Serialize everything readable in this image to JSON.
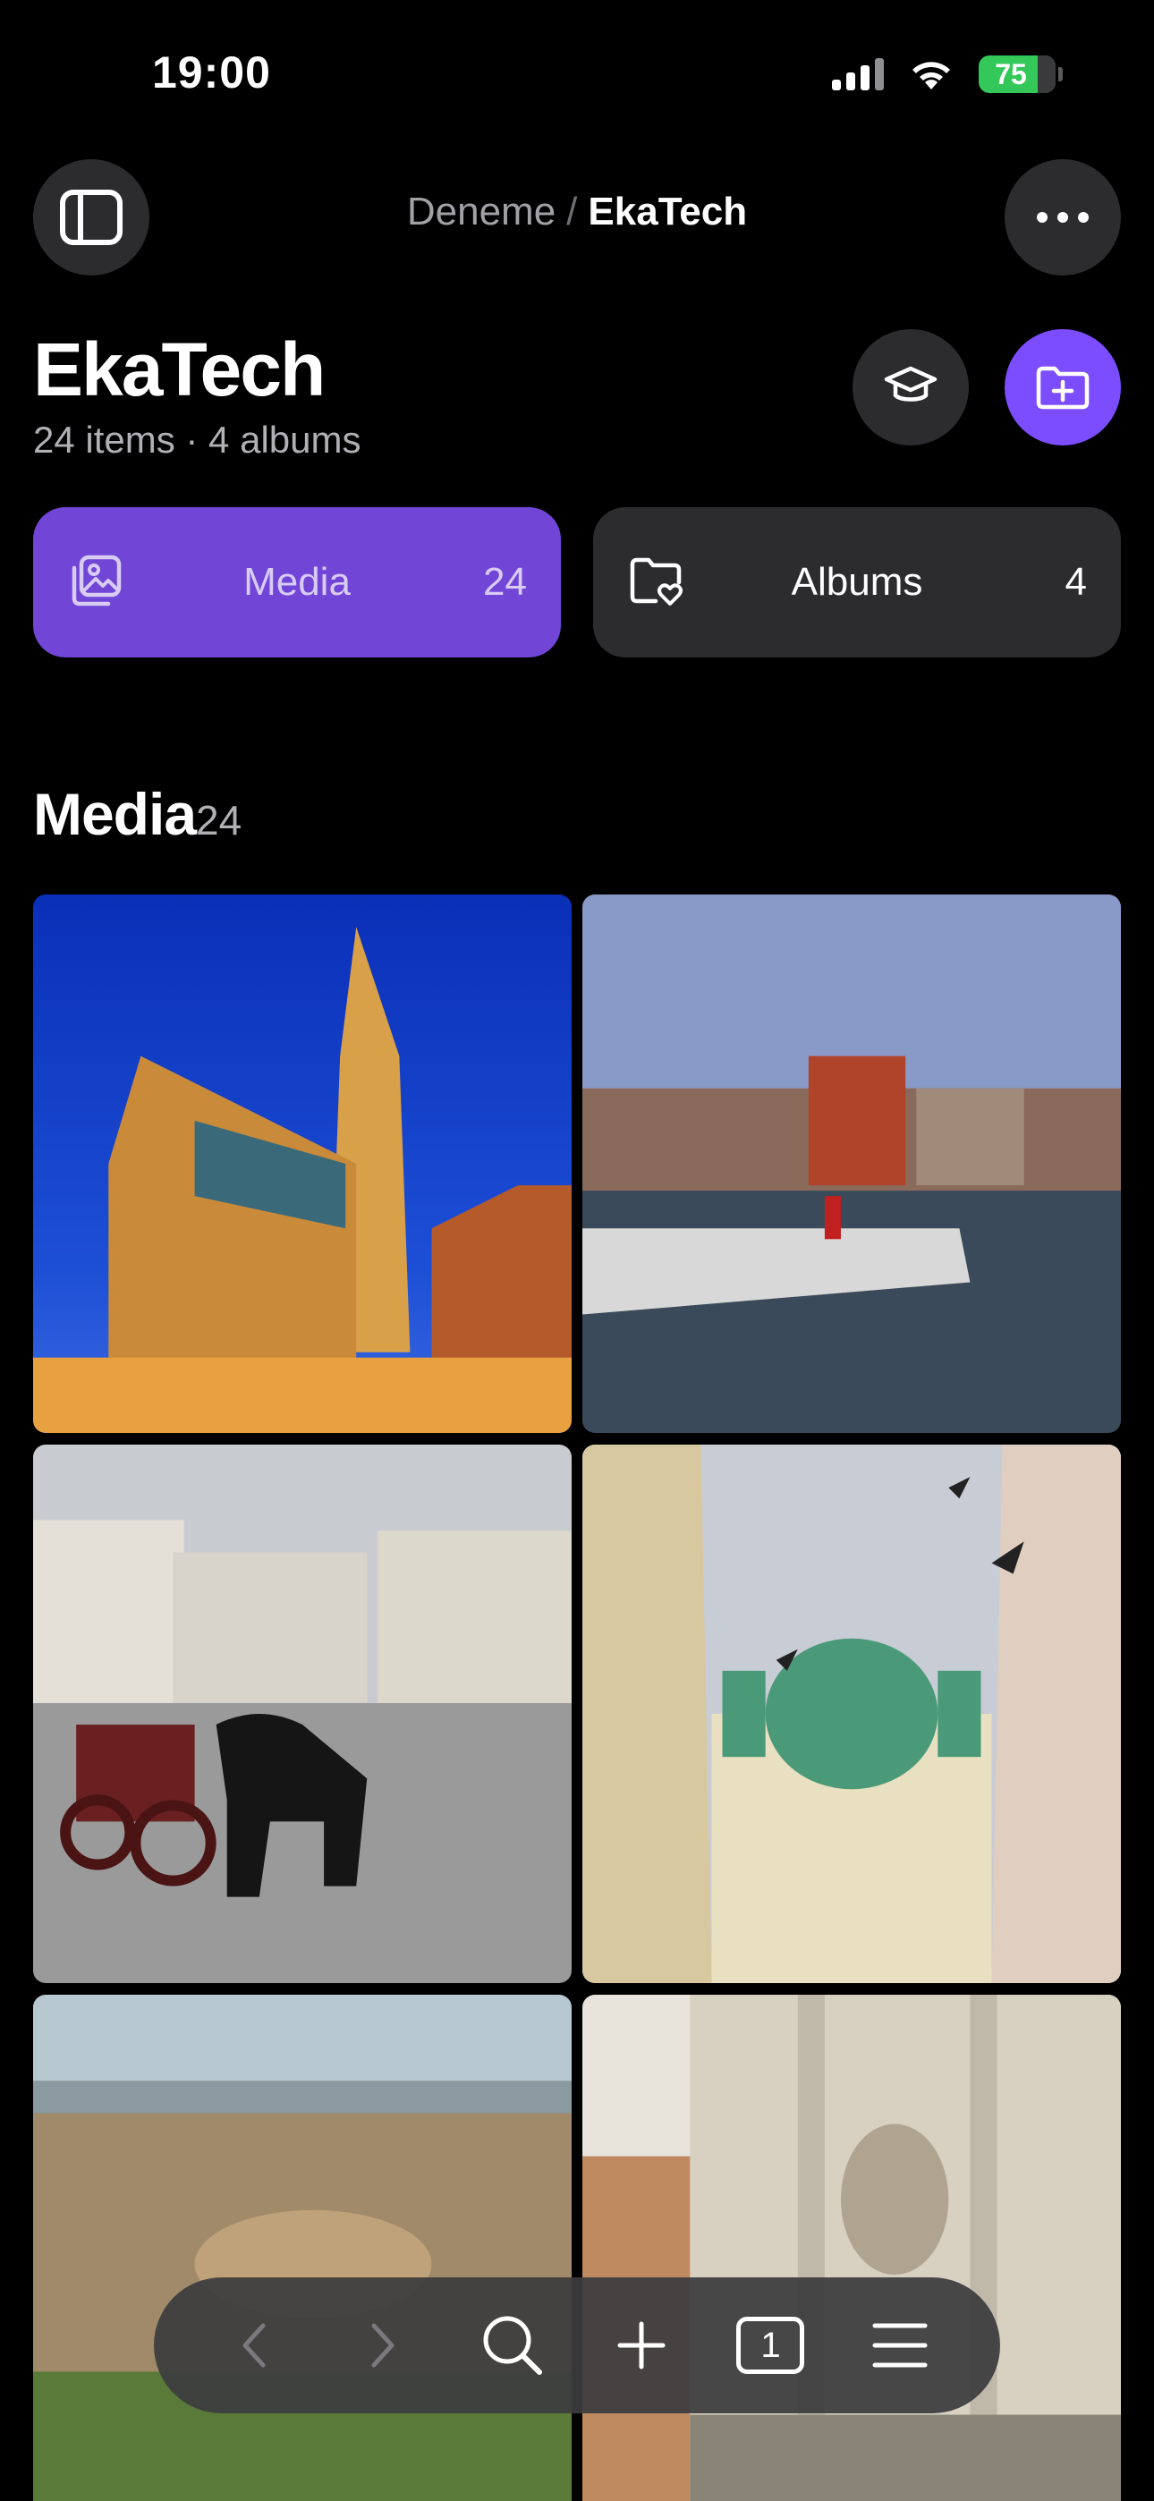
{
  "status_bar": {
    "time": "19:00",
    "battery": "75"
  },
  "nav": {
    "breadcrumb_parent": "Deneme",
    "breadcrumb_separator": "/",
    "breadcrumb_current": "EkaTech"
  },
  "header": {
    "title": "EkaTech",
    "subtitle": "24 items · 4 albums"
  },
  "tabs": [
    {
      "label": "Media",
      "count": "24",
      "icon": "photo-stack-icon",
      "active": true
    },
    {
      "label": "Albums",
      "count": "4",
      "icon": "folder-heart-icon",
      "active": false
    }
  ],
  "section": {
    "title": "Media",
    "count": "24"
  },
  "colors": {
    "accent": "#7c4dff",
    "active_tab": "#7145d6",
    "surface": "#2c2c2e",
    "background": "#000000"
  },
  "toolbar_icons": [
    "back-icon",
    "forward-icon",
    "search-icon",
    "plus-icon",
    "tabs-icon",
    "menu-icon"
  ],
  "toolbar": {
    "tab_count": "1"
  }
}
